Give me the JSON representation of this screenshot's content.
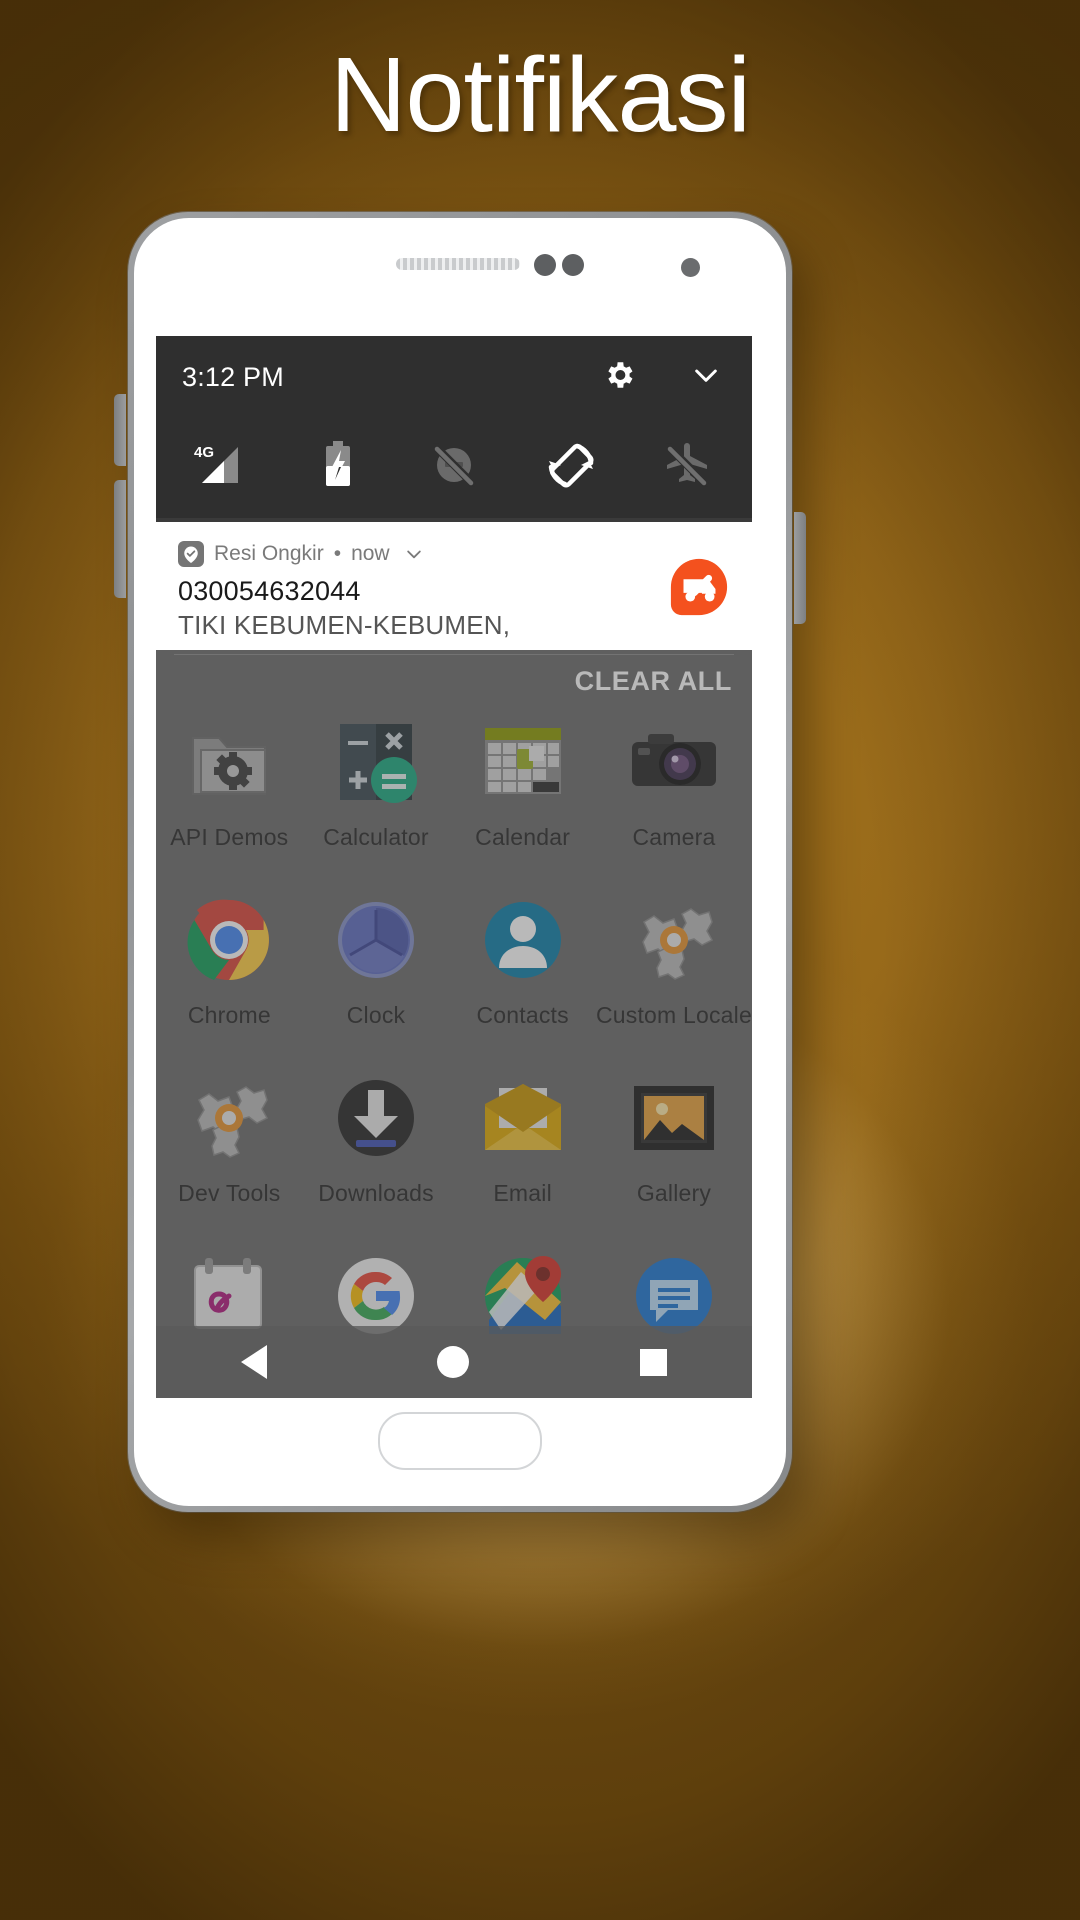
{
  "page": {
    "title": "Notifikasi",
    "background_color": "#97691a",
    "title_color": "#ffffff"
  },
  "status_bar": {
    "clock": "3:12 PM",
    "settings_icon": "gear-icon",
    "collapse_icon": "chevron-down-icon",
    "quick_icons": [
      {
        "name": "signal-4g-icon",
        "label": "4G"
      },
      {
        "name": "battery-charging-icon",
        "label": ""
      },
      {
        "name": "do-not-disturb-off-icon",
        "label": ""
      },
      {
        "name": "auto-rotate-icon",
        "label": ""
      },
      {
        "name": "airplane-mode-off-icon",
        "label": ""
      }
    ]
  },
  "notification": {
    "app_name": "Resi Ongkir",
    "separator": "•",
    "time": "now",
    "expand_icon": "chevron-down-icon",
    "title": "030054632044",
    "body": "TIKI KEBUMEN-KEBUMEN,",
    "app_icon": "delivery-check-pin-icon",
    "app_icon_color": "#F4511E"
  },
  "shade": {
    "clear_all_label": "CLEAR ALL"
  },
  "app_drawer": {
    "apps": [
      {
        "label": "API Demos",
        "icon": "folder-gear-icon"
      },
      {
        "label": "Calculator",
        "icon": "calculator-icon"
      },
      {
        "label": "Calendar",
        "icon": "calendar-icon"
      },
      {
        "label": "Camera",
        "icon": "camera-icon"
      },
      {
        "label": "Chrome",
        "icon": "chrome-icon"
      },
      {
        "label": "Clock",
        "icon": "clock-icon"
      },
      {
        "label": "Contacts",
        "icon": "contacts-icon"
      },
      {
        "label": "Custom Locale",
        "icon": "gears-locale-icon"
      },
      {
        "label": "Dev Tools",
        "icon": "gears-devtools-icon"
      },
      {
        "label": "Downloads",
        "icon": "download-icon"
      },
      {
        "label": "Email",
        "icon": "email-envelope-icon"
      },
      {
        "label": "Gallery",
        "icon": "gallery-photo-icon"
      },
      {
        "label": "",
        "icon": "calendar-alpha-icon"
      },
      {
        "label": "",
        "icon": "google-g-icon"
      },
      {
        "label": "",
        "icon": "maps-pin-icon"
      },
      {
        "label": "",
        "icon": "messages-icon"
      }
    ]
  },
  "nav_bar": {
    "back": "back-triangle-icon",
    "home": "home-circle-icon",
    "recents": "recents-square-icon"
  }
}
